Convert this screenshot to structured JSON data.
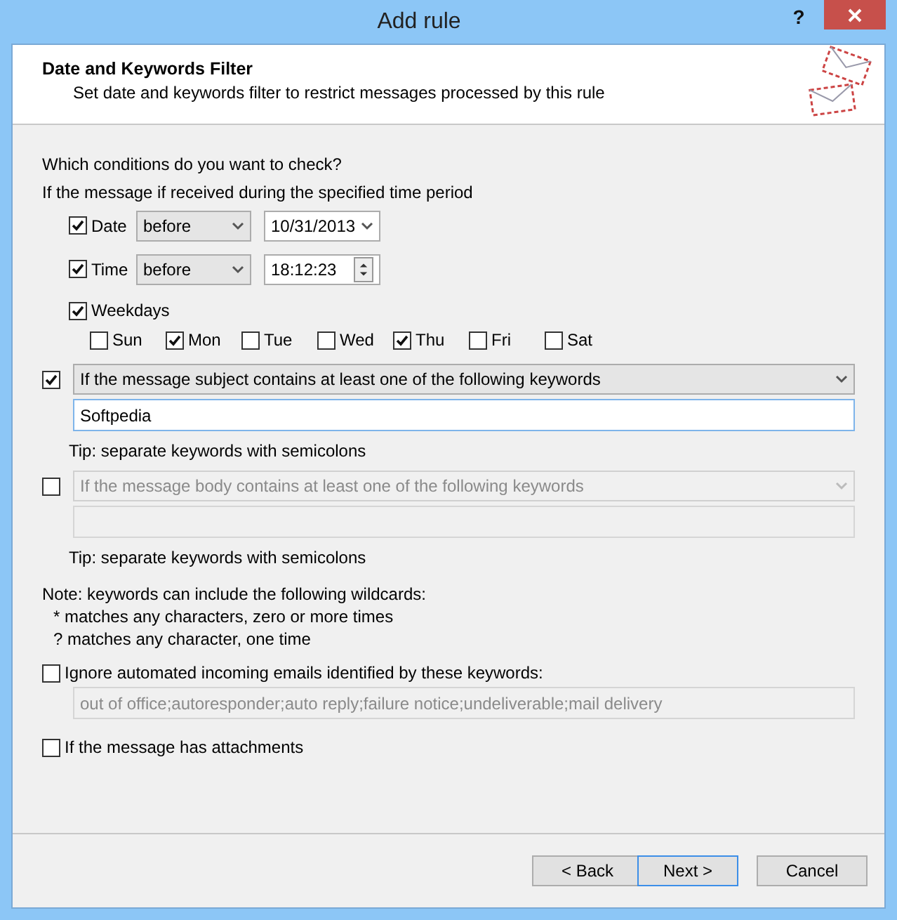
{
  "window": {
    "title": "Add rule",
    "help": "?"
  },
  "header": {
    "title": "Date and Keywords Filter",
    "subtitle": "Set date and keywords filter to restrict messages processed by this rule"
  },
  "question": "Which conditions do you want to check?",
  "period_label": "If the message if received during the specified time period",
  "period_rows": [
    {
      "kind": "date",
      "label": "Date",
      "checked": true,
      "operator": "before",
      "value": "10/31/2013"
    },
    {
      "kind": "time",
      "label": "Time",
      "checked": true,
      "operator": "before",
      "value": "18:12:23"
    }
  ],
  "weekdays": {
    "label": "Weekdays",
    "checked": true,
    "days": [
      {
        "label": "Sun",
        "checked": false
      },
      {
        "label": "Mon",
        "checked": true
      },
      {
        "label": "Tue",
        "checked": false
      },
      {
        "label": "Wed",
        "checked": false
      },
      {
        "label": "Thu",
        "checked": true
      },
      {
        "label": "Fri",
        "checked": false
      },
      {
        "label": "Sat",
        "checked": false
      }
    ]
  },
  "keyword_filters": [
    {
      "checked": true,
      "condition": "If the message subject contains at least one of the following keywords",
      "value": "Softpedia",
      "tip": "Tip: separate keywords with semicolons"
    },
    {
      "checked": false,
      "condition": "If the message body contains at least one of the following keywords",
      "tip": "Tip: separate keywords with semicolons"
    }
  ],
  "note": {
    "heading": "Note: keywords can include the following wildcards:",
    "lines": [
      "* matches any characters, zero or more times",
      "? matches any character, one time"
    ]
  },
  "ignore": {
    "label": "Ignore automated incoming emails identified by these keywords:",
    "checked": false,
    "value": "out of office;autoresponder;auto reply;failure notice;undeliverable;mail delivery"
  },
  "attachments": {
    "label": "If the message has attachments",
    "checked": false
  },
  "buttons": [
    {
      "label": "< Back",
      "focused": false
    },
    {
      "label": "Next >",
      "focused": true
    },
    {
      "label": "Cancel",
      "focused": false
    }
  ]
}
